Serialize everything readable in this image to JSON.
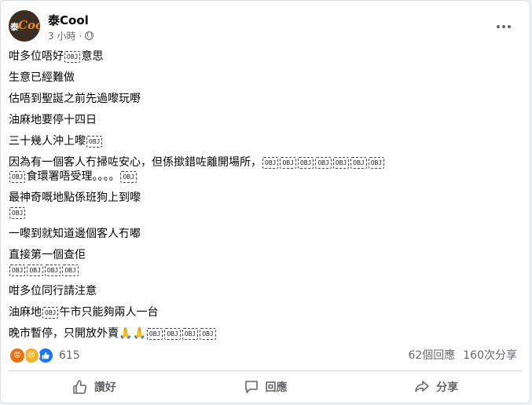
{
  "post": {
    "author": "泰Cool",
    "avatar_text": {
      "a1": "泰",
      "a2": "Cool"
    },
    "time": "3 小時",
    "privacy_icon": "globe-icon",
    "more_icon": "more-dots-icon"
  },
  "lines": [
    {
      "parts": [
        "咁多位唔好",
        "[OBJ]",
        "意思"
      ]
    },
    {
      "parts": [
        "生意已經難做"
      ]
    },
    {
      "parts": [
        "估唔到聖誕之前先過嚟玩嘢"
      ]
    },
    {
      "parts": [
        "油麻地要停十四日"
      ]
    },
    {
      "parts": [
        "三十幾人沖上嚟",
        "[OBJ]"
      ]
    },
    {
      "parts": [
        "因為有一個客人冇掃咗安心，但係撳錯咗離開場所，",
        "[OBJ]",
        "[OBJ]",
        "[OBJ]",
        "[OBJ]",
        "[OBJ]",
        "[OBJ]",
        "[OBJ]",
        "[OBJ]",
        "食環署唔受理。。。。",
        "[OBJ]"
      ]
    },
    {
      "parts": [
        "最神奇嘅地點係班狗上到嚟"
      ]
    },
    {
      "parts": [
        "[OBJ]"
      ]
    },
    {
      "parts": [
        "一嚟到就知道邊個客人冇嘟"
      ]
    },
    {
      "parts": [
        "直接第一個查佢"
      ]
    },
    {
      "parts": [
        "[OBJ]",
        "[OBJ]",
        "[OBJ]",
        "[OBJ]"
      ]
    },
    {
      "parts": [
        "咁多位同行請注意"
      ]
    },
    {
      "parts": [
        "油麻地",
        "[OBJ]",
        "午市只能夠兩人一台"
      ]
    },
    {
      "parts": [
        "晚市暫停，只開放外賣",
        "🙏",
        "🙏",
        "[OBJ]",
        "[OBJ]",
        "[OBJ]",
        "[OBJ]"
      ]
    }
  ],
  "stats": {
    "reactions_count": "615",
    "reaction_icons": [
      "angry-icon",
      "sad-icon",
      "like-icon"
    ],
    "comments": "62個回應",
    "shares": "160次分享"
  },
  "actions": {
    "like": "讚好",
    "comment": "回應",
    "share": "分享"
  },
  "colors": {
    "text": "#050505",
    "secondary": "#65676b",
    "like_blue": "#1877f2",
    "angry": "#e9710f",
    "sad": "#f7b125"
  }
}
